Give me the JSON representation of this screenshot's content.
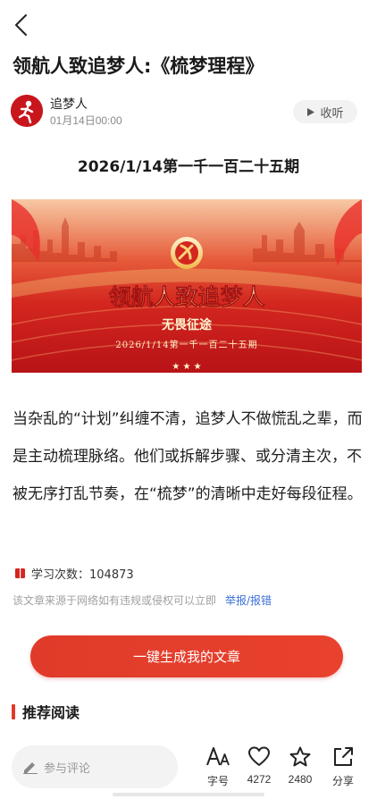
{
  "header": {
    "back_icon": "chevron-left-icon"
  },
  "article": {
    "title": "领航人致追梦人:《梳梦理程》",
    "author": {
      "name": "追梦人",
      "date": "01月14日00:00"
    },
    "listen_label": "收听",
    "period_heading": "2026/1/14第一千一百二十五期",
    "banner": {
      "main_text": "领航人致追梦人",
      "sub_text": "无畏征途",
      "date_text": "2026/1/14第一千一百二十五期",
      "colors": {
        "red": "#c8161d",
        "gold": "#f6d27a"
      }
    },
    "body": "当杂乱的“计划”纠缠不清，追梦人不做慌乱之辈，而是主动梳理脉络。他们或拆解步骤、或分清主次，不被无序打乱节奏，在“梳梦”的清晰中走好每段征程。",
    "study_count": "学习次数：104873",
    "disclaimer": "该文章来源于网络如有违规或侵权可以立即",
    "report_link": "举报/报错"
  },
  "generate_button": "一键生成我的文章",
  "recommend_title": "推荐阅读",
  "bottom_bar": {
    "comment_placeholder": "参与评论",
    "font_label": "字号",
    "like_count": "4272",
    "favorite_count": "2480",
    "share_label": "分享"
  },
  "colors": {
    "accent": "#e23a2a",
    "link": "#3a6fd8"
  }
}
